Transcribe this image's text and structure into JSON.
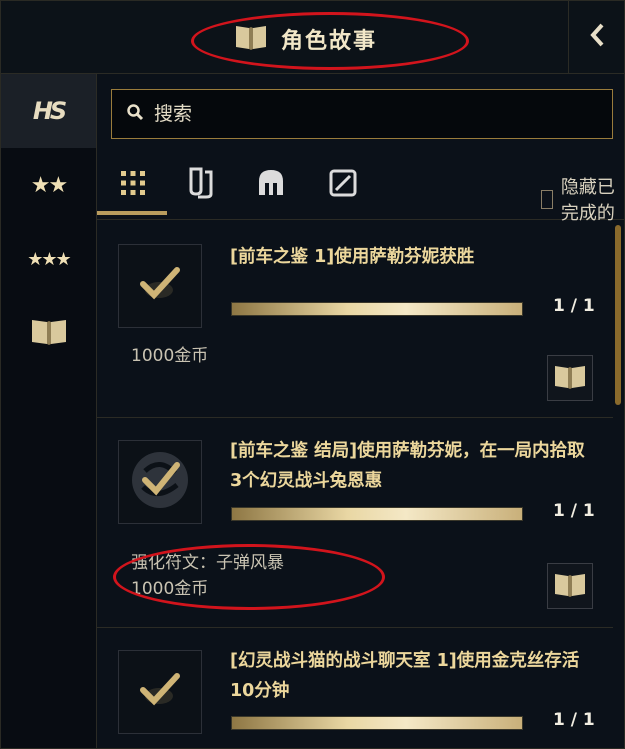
{
  "header": {
    "title": "角色故事",
    "book_icon": "book-icon",
    "collapse_icon": "chevron-left-icon"
  },
  "sidebar": {
    "items": [
      {
        "label": "HS",
        "name": "logo",
        "active": true
      },
      {
        "label": "★★",
        "name": "two-stars"
      },
      {
        "label": "★★★",
        "name": "three-stars"
      },
      {
        "label": "",
        "name": "book"
      }
    ]
  },
  "search": {
    "placeholder": "搜索"
  },
  "filters": {
    "tabs": [
      "grid-icon",
      "card-stack-icon",
      "helmet-icon",
      "slash-box-icon"
    ],
    "hide_completed_label": "隐藏已完成的"
  },
  "quests": [
    {
      "title": "[前车之鉴 1]使用萨勒芬妮获胜",
      "progress_text": "1 / 1",
      "progress": 1.0,
      "reward_lines": [
        "1000金币"
      ]
    },
    {
      "title": "[前车之鉴 结局]使用萨勒芬妮，在一局内拾取3个幻灵战斗兔恩惠",
      "progress_text": "1 / 1",
      "progress": 1.0,
      "reward_lines": [
        "强化符文：子弹风暴",
        "1000金币"
      ]
    },
    {
      "title": "[幻灵战斗猫的战斗聊天室 1]使用金克丝存活10分钟",
      "progress_text": "1 / 1",
      "progress": 1.0,
      "reward_lines": []
    }
  ],
  "colors": {
    "accent_gold": "#b99c5e",
    "annotation_red": "#d2141c"
  }
}
